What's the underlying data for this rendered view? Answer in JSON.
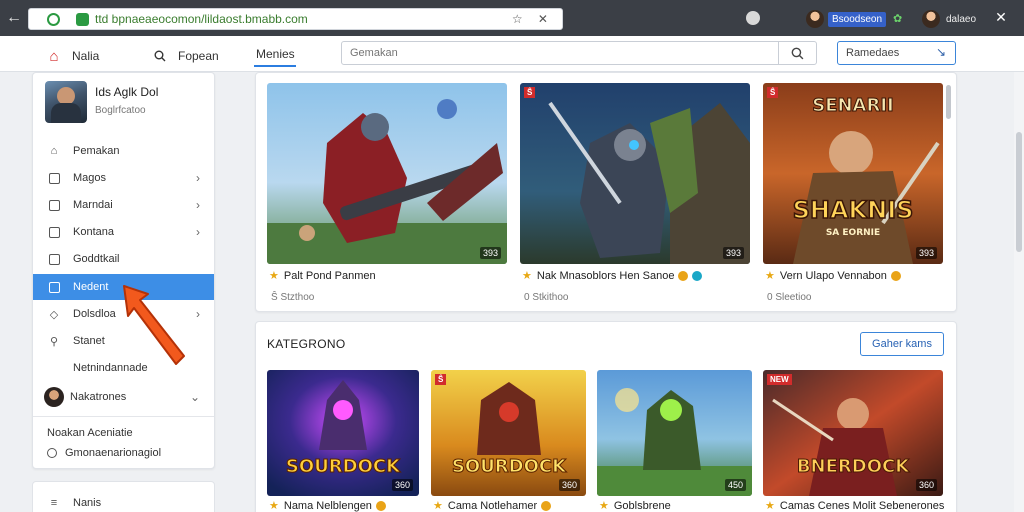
{
  "browser": {
    "back_glyph": "←",
    "url": "ttd bpnaeaeocomon/lildaost.bmabb.com",
    "tools": "☆ ✕",
    "profile_label": "Bsoodseon",
    "small_badge": "✿",
    "profile_b_label": "dalaeo",
    "close_glyph": "✕"
  },
  "appbar": {
    "nav": [
      {
        "label": "Nalia",
        "icon": "home-icon"
      },
      {
        "label": "Fopean",
        "icon": "search-icon"
      }
    ],
    "active_tab": "Menies",
    "search_placeholder": "Gemakan",
    "filter_label": "Ramedaes",
    "filter_glyph": "↘"
  },
  "sidebar": {
    "user_name": "Ids Aglk Dol",
    "user_sub": "Boglrfcatoo",
    "items": [
      {
        "label": "Pemakan",
        "icon": "house-icon",
        "chevron": ""
      },
      {
        "label": "Magos",
        "icon": "grid-icon",
        "chevron": "›"
      },
      {
        "label": "Marndai",
        "icon": "grid-icon",
        "chevron": "›"
      },
      {
        "label": "Kontana",
        "icon": "grid-icon",
        "chevron": "›"
      },
      {
        "label": "Goddtkail",
        "icon": "grid-icon",
        "chevron": ""
      },
      {
        "label": "Nedent",
        "icon": "grid-icon",
        "chevron": ""
      },
      {
        "label": "Dolsdloa",
        "icon": "drop-icon",
        "chevron": "›"
      },
      {
        "label": "Stanet",
        "icon": "pin-icon",
        "chevron": ""
      },
      {
        "label": "Netnindannade",
        "icon": "",
        "chevron": ""
      },
      {
        "label": "Nakatrones",
        "icon": "avatar-icon",
        "chevron": "⌄"
      }
    ],
    "section_label": "Noakan Aceniatie",
    "footer_item": "Gmonaenarionagiol",
    "second_panel_item": "Nanis"
  },
  "featured": [
    {
      "title": "Palt Pond Panmen",
      "meta": "Ŝ Stzthoo",
      "count": "393",
      "tag": "",
      "coin": false
    },
    {
      "title": "Nak Mnasoblors Hen Sanoe",
      "meta": "0 Stkithoo",
      "count": "393",
      "tag": "Ŝ",
      "coin": true
    },
    {
      "title": "Vern Ulapo Vennabon",
      "meta": "0 Sleetioo",
      "count": "393",
      "tag": "Ŝ",
      "coin": true,
      "art_title": "SENARII",
      "art_sub": "SHAKNIS",
      "art_tag": "SA EORNIE"
    }
  ],
  "section": {
    "title": "KATEGRONO",
    "button_label": "Gaher kams"
  },
  "grid": [
    {
      "title": "Nama Nelblengen",
      "count": "360",
      "tag": "",
      "art_title": "SOURDOCK"
    },
    {
      "title": "Cama Notlehamer",
      "count": "360",
      "tag": "Ŝ",
      "art_title": "SOURDOCK"
    },
    {
      "title": "Goblsbrene",
      "count": "450",
      "tag": "",
      "art_title": ""
    },
    {
      "title": "Camas Cenes Molit Sebenerones",
      "count": "360",
      "tag": "NEW",
      "art_title": "BNERDOCK"
    }
  ]
}
